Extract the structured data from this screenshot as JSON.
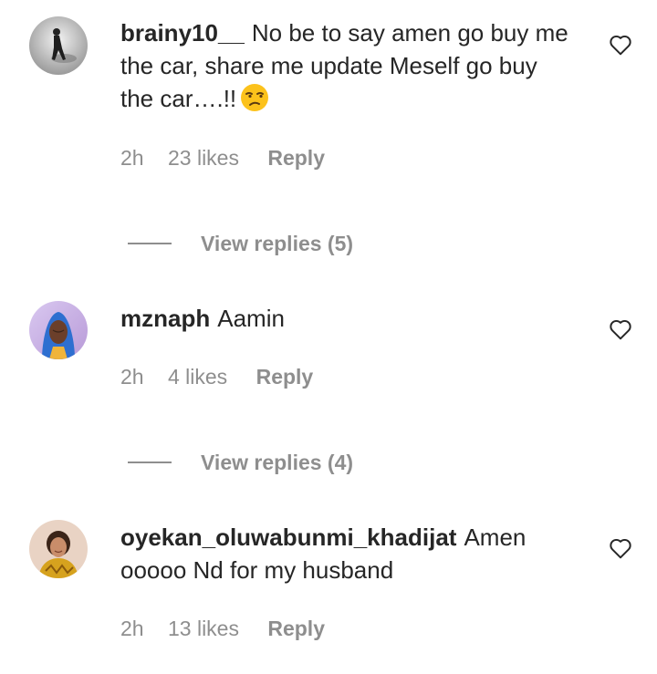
{
  "comments": [
    {
      "username": "brainy10__",
      "text": "No be to say amen go buy me the car, share me update Meself go buy the car….!!",
      "emoji": "unamused-face",
      "time": "2h",
      "likes": "23 likes",
      "reply_label": "Reply",
      "view_replies": "View replies (5)"
    },
    {
      "username": "mznaph",
      "text": "Aamin",
      "time": "2h",
      "likes": "4 likes",
      "reply_label": "Reply",
      "view_replies": "View replies (4)"
    },
    {
      "username": "oyekan_oluwabunmi_khadijat",
      "text": "Amen ooooo Nd for my husband",
      "time": "2h",
      "likes": "13 likes",
      "reply_label": "Reply"
    }
  ],
  "icons": {
    "like": "heart-outline-icon"
  },
  "colors": {
    "text": "#262626",
    "secondary": "#8e8e8e",
    "background": "#ffffff"
  }
}
